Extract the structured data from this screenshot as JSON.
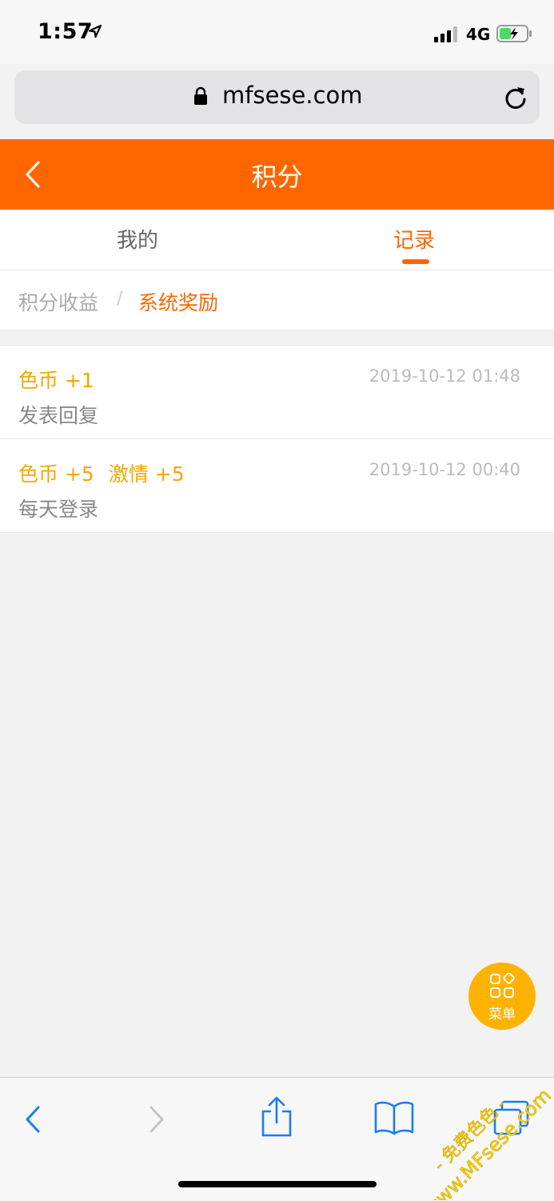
{
  "status_bar": {
    "time": "1:57",
    "network": "4G"
  },
  "address_bar": {
    "url": "mfsese.com"
  },
  "header": {
    "title": "积分"
  },
  "tabs": [
    {
      "label": "我的",
      "active": false
    },
    {
      "label": "记录",
      "active": true
    }
  ],
  "sub_nav": {
    "item1": "积分收益",
    "separator": "/",
    "item2": "系统奖励",
    "active": "系统奖励"
  },
  "records": [
    {
      "rewards": [
        "色币 +1"
      ],
      "time": "2019-10-12 01:48",
      "description": "发表回复"
    },
    {
      "rewards": [
        "色币 +5",
        "激情 +5"
      ],
      "time": "2019-10-12 00:40",
      "description": "每天登录"
    }
  ],
  "fab": {
    "label": "菜单"
  },
  "watermark": {
    "line1": "- 免费色色 -",
    "line2": "www.MFsese.com"
  },
  "colors": {
    "accent": "#ff6600",
    "reward": "#f7a500",
    "fab": "#ffb300",
    "ios_blue": "#1a7cf5"
  }
}
